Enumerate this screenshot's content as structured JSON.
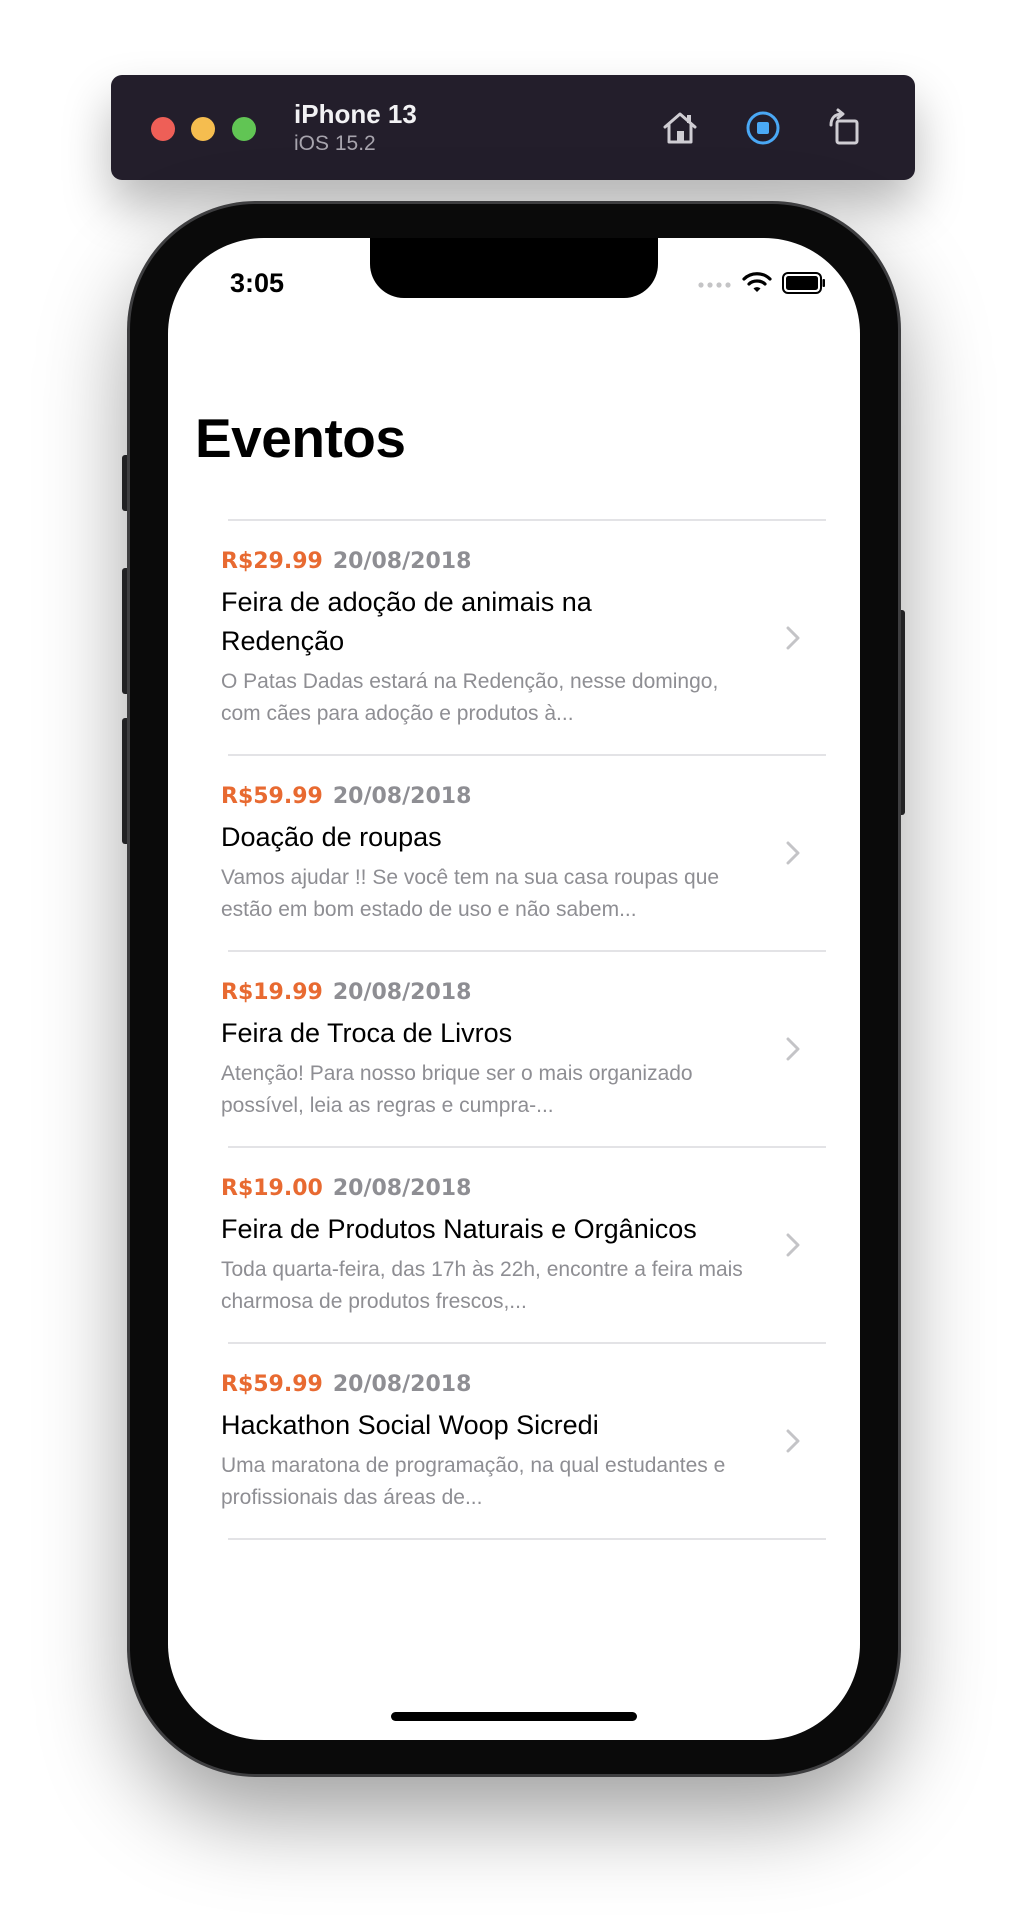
{
  "simulator": {
    "device_name": "iPhone 13",
    "os_version": "iOS 15.2",
    "icons": [
      "home-icon",
      "screenshot-icon",
      "rotate-icon"
    ],
    "colors": {
      "close": "#ee5f57",
      "minimize": "#f5bd4f",
      "zoom": "#61c554",
      "accent": "#4aa8f5"
    }
  },
  "status_bar": {
    "time": "3:05",
    "icons": [
      "cellular-dots-icon",
      "wifi-icon",
      "battery-icon"
    ]
  },
  "nav": {
    "title": "Eventos"
  },
  "colors": {
    "price": "#e86a31",
    "secondary_text": "#8e8e93"
  },
  "events": [
    {
      "price": "R$29.99",
      "date": "20/08/2018",
      "title": "Feira de adoção de animais na Redenção",
      "description": "O Patas Dadas estará na Redenção, nesse domingo, com cães para adoção e produtos à..."
    },
    {
      "price": "R$59.99",
      "date": "20/08/2018",
      "title": "Doação de roupas",
      "description": "Vamos ajudar !!  Se você tem na sua casa roupas que estão em bom estado de uso e não sabem..."
    },
    {
      "price": "R$19.99",
      "date": "20/08/2018",
      "title": "Feira de Troca de Livros",
      "description": "Atenção! Para nosso brique ser o mais organizado possível, leia as regras e cumpra-..."
    },
    {
      "price": "R$19.00",
      "date": "20/08/2018",
      "title": "Feira de Produtos Naturais e Orgânicos",
      "description": "Toda quarta-feira, das 17h às 22h, encontre a feira mais charmosa de produtos frescos,..."
    },
    {
      "price": "R$59.99",
      "date": "20/08/2018",
      "title": "Hackathon Social Woop Sicredi",
      "description": "Uma maratona de programação, na qual estudantes e profissionais das áreas de..."
    }
  ]
}
